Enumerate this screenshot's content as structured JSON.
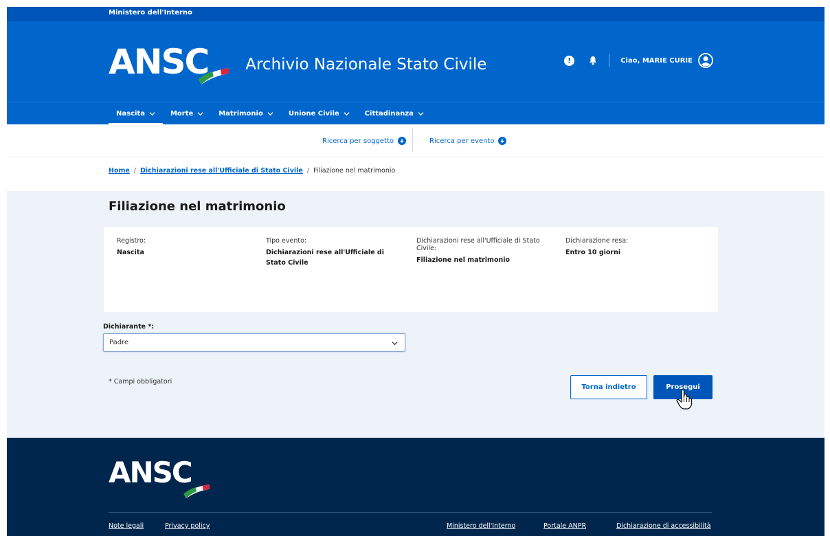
{
  "slim_header": {
    "label": "Ministero dell'Interno"
  },
  "header": {
    "logo_text": "ANSC",
    "title": "Archivio Nazionale Stato Civile",
    "greeting": "Ciao, MARIE CURIE",
    "colors": {
      "primary": "#0066cc",
      "dark": "#0055b8",
      "footer": "#01264d"
    }
  },
  "nav": {
    "items": [
      {
        "label": "Nascita"
      },
      {
        "label": "Morte"
      },
      {
        "label": "Matrimonio"
      },
      {
        "label": "Unione Civile"
      },
      {
        "label": "Cittadinanza"
      }
    ]
  },
  "subnav": {
    "search_subject": "Ricerca per soggetto",
    "search_event": "Ricerca per evento"
  },
  "breadcrumb": {
    "home": "Home",
    "section": "Dichiarazioni rese all'Ufficiale di Stato Civile",
    "current": "Filiazione nel matrimonio"
  },
  "main": {
    "title": "Filiazione nel matrimonio",
    "info": [
      {
        "label": "Registro:",
        "value": "Nascita"
      },
      {
        "label": "Tipo evento:",
        "value": "Dichiarazioni rese all'Ufficiale di Stato Civile"
      },
      {
        "label": "Dichiarazioni rese all'Ufficiale di Stato Civile:",
        "value": "Filiazione nel matrimonio"
      },
      {
        "label": "Dichiarazione resa:",
        "value": "Entro 10 giorni"
      }
    ],
    "declarant": {
      "label": "Dichiarante *:",
      "value": "Padre"
    },
    "required_note": "* Campi obbligatori",
    "back_button": "Torna indietro",
    "next_button": "Prosegui"
  },
  "footer": {
    "logo_text": "ANSC",
    "links_left": [
      "Note legali",
      "Privacy policy"
    ],
    "links_right": [
      "Ministero dell'Interno",
      "Portale ANPR",
      "Dichiarazione di accessibilità"
    ]
  }
}
